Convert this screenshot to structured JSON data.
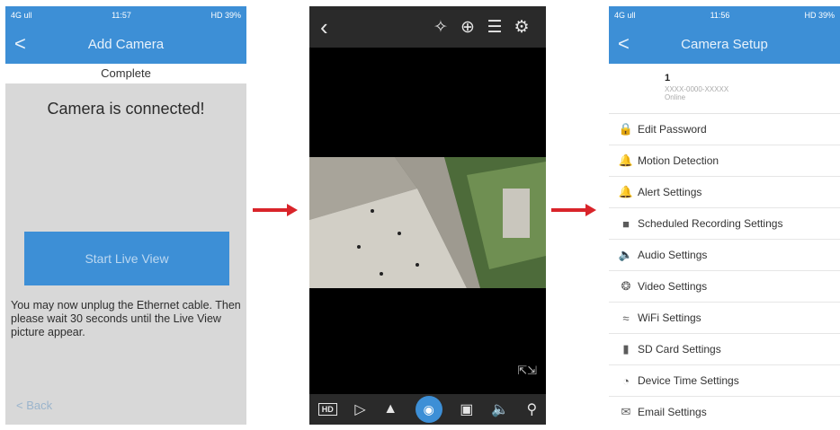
{
  "panel1": {
    "status": {
      "left": "4G ull",
      "time": "11:57",
      "right": "HD 39%"
    },
    "nav": {
      "back": "<",
      "title": "Add Camera"
    },
    "complete_label": "Complete",
    "heading": "Camera is connected!",
    "live_view_button": "Start Live View",
    "note": "You may now unplug the Ethernet cable. Then please wait 30 seconds until the Live View picture appear.",
    "back_link": "< Back"
  },
  "panel2": {
    "top_icons": [
      "back-icon",
      "ptz-icon",
      "zoom-icon",
      "adjust-icon",
      "settings-icon"
    ],
    "bottom_icons": [
      "hd-icon",
      "flip-icon",
      "mirror-icon",
      "snapshot-icon",
      "record-icon",
      "speaker-icon",
      "microphone-icon"
    ],
    "hd_label": "HD"
  },
  "panel3": {
    "status": {
      "left": "4G ull",
      "time": "11:56",
      "right": "HD 39%"
    },
    "nav": {
      "back": "<",
      "title": "Camera Setup"
    },
    "device": {
      "name": "1",
      "id": "XXXX-0000-XXXXX",
      "status": "Online"
    },
    "menu": [
      {
        "label": "Edit Password",
        "icon": "lock-icon"
      },
      {
        "label": "Motion Detection",
        "icon": "bell-icon"
      },
      {
        "label": "Alert Settings",
        "icon": "bell-icon"
      },
      {
        "label": "Scheduled Recording Settings",
        "icon": "video-icon"
      },
      {
        "label": "Audio Settings",
        "icon": "speaker-icon"
      },
      {
        "label": "Video Settings",
        "icon": "film-reel-icon"
      },
      {
        "label": "WiFi Settings",
        "icon": "wifi-icon"
      },
      {
        "label": "SD Card Settings",
        "icon": "sd-card-icon"
      },
      {
        "label": "Device Time Settings",
        "icon": "clock-icon"
      },
      {
        "label": "Email Settings",
        "icon": "mail-icon"
      }
    ]
  },
  "colors": {
    "accent": "#3d8fd6",
    "arrow": "#d9242a"
  }
}
